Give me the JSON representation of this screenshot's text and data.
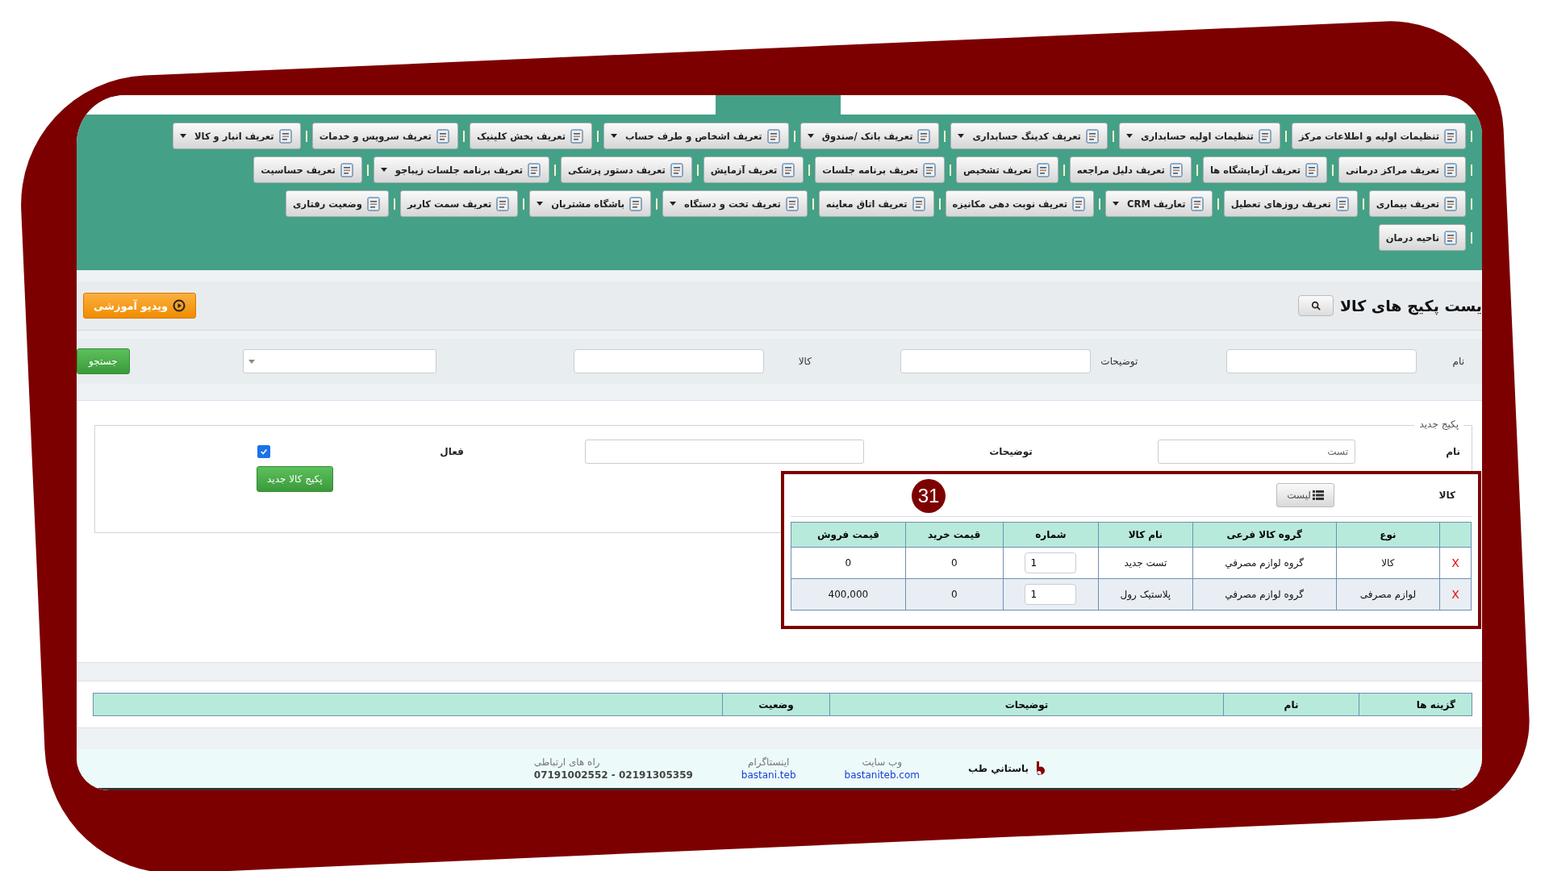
{
  "menu": {
    "lines": [
      {
        "buttons": [
          {
            "label": "تنظیمات اولیه و اطلاعات مرکز",
            "dropdown": false
          },
          {
            "label": "تنظیمات اولیه حسابداری",
            "dropdown": true
          },
          {
            "label": "تعریف کدینگ حسابداری",
            "dropdown": true
          },
          {
            "label": "تعریف بانک /صندوق",
            "dropdown": true
          },
          {
            "label": "تعریف اشخاص و طرف حساب",
            "dropdown": true
          },
          {
            "label": "تعریف بخش کلینیک",
            "dropdown": false
          },
          {
            "label": "تعریف سرویس و خدمات",
            "dropdown": false
          },
          {
            "label": "تعریف انبار و کالا",
            "dropdown": true
          }
        ]
      },
      {
        "buttons": [
          {
            "label": "تعریف مراکز درمانی",
            "dropdown": false
          },
          {
            "label": "تعریف آزمایشگاه ها",
            "dropdown": false
          },
          {
            "label": "تعریف دلیل مراجعه",
            "dropdown": false
          },
          {
            "label": "تعریف تشخیص",
            "dropdown": false
          },
          {
            "label": "تعریف برنامه جلسات",
            "dropdown": false
          },
          {
            "label": "تعریف آزمایش",
            "dropdown": false
          },
          {
            "label": "تعریف دستور پزشکی",
            "dropdown": false
          },
          {
            "label": "تعریف برنامه جلسات زیباجو",
            "dropdown": true
          },
          {
            "label": "تعریف حساسیت",
            "dropdown": false
          }
        ]
      },
      {
        "buttons": [
          {
            "label": "تعریف بیماری",
            "dropdown": false
          },
          {
            "label": "تعریف روزهای تعطیل",
            "dropdown": false
          },
          {
            "label": "تعاریف CRM",
            "dropdown": true
          },
          {
            "label": "تعریف نوبت دهی مکانیزه",
            "dropdown": false
          },
          {
            "label": "تعریف اتاق معاینه",
            "dropdown": false
          },
          {
            "label": "تعریف تخت و دستگاه",
            "dropdown": true
          },
          {
            "label": "باشگاه مشتریان",
            "dropdown": true
          },
          {
            "label": "تعریف سمت کاربر",
            "dropdown": false
          },
          {
            "label": "وضعیت رفتاری",
            "dropdown": false
          }
        ]
      },
      {
        "buttons": [
          {
            "label": "ناحیه درمان",
            "dropdown": false
          }
        ]
      }
    ]
  },
  "header": {
    "title": "یست پکیج های کالا",
    "video_button": "ویدیو آموزشی"
  },
  "search": {
    "fields": [
      {
        "label": "نام",
        "kind": "text"
      },
      {
        "label": "توضیحات",
        "kind": "text"
      },
      {
        "label": "کالا",
        "kind": "text"
      },
      {
        "kind": "select"
      }
    ],
    "button": "جستجو"
  },
  "new_package": {
    "legend": "پکیج جدید",
    "name_label": "نام",
    "name_value": "تست",
    "description_label": "توضیحات",
    "active_label": "فعال",
    "active": true,
    "goods_label": "کالا",
    "list_button": "لیست",
    "create_button": "پکیج کالا جدید",
    "badge": "31",
    "table": {
      "columns": [
        "نوع",
        "گروه کالا فرعی",
        "نام کالا",
        "شماره",
        "قیمت خرید",
        "قیمت فروش"
      ],
      "rows": [
        {
          "delete": "X",
          "type": "کالا",
          "subgroup": "گروه لوازم مصرفي",
          "name": "تست جديد",
          "count": "1",
          "buy": "0",
          "sell": "0"
        },
        {
          "delete": "X",
          "type": "لوازم مصرفی",
          "subgroup": "گروه لوازم مصرفي",
          "name": "پلاستیک رول",
          "count": "1",
          "buy": "0",
          "sell": "400,000"
        }
      ]
    }
  },
  "packages_table": {
    "columns": [
      "گزینه ها",
      "نام",
      "توضیحات",
      "وضعیت"
    ]
  },
  "footer": {
    "brand": "باستاني طب",
    "links": [
      {
        "label": "وب سایت",
        "value": "bastaniteb.com",
        "kind": "link"
      },
      {
        "label": "اینستاگرام",
        "value": "bastani.teb",
        "kind": "link"
      },
      {
        "label": "راه های ارتباطی",
        "value": "07191002552 - 02191305359",
        "kind": "text"
      }
    ]
  }
}
